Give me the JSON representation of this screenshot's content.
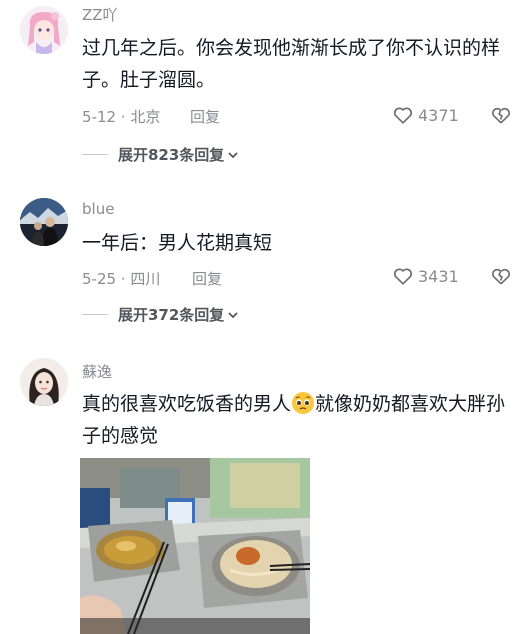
{
  "comments": [
    {
      "username": "ZZ吖",
      "text": "过几年之后。你会发现他渐渐长成了你不认识的样子。肚子溜圆。",
      "date_location": "5-12 · 北京",
      "reply_label": "回复",
      "likes": "4371",
      "expand_label": "展开823条回复"
    },
    {
      "username": "blue",
      "text": "一年后：男人花期真短",
      "date_location": "5-25 · 四川",
      "reply_label": "回复",
      "likes": "3431",
      "expand_label": "展开372条回复"
    },
    {
      "username": "蘇逸",
      "text_part1": "真的很喜欢吃饭香的男人",
      "text_part2": "就像奶奶都喜欢大胖孙子的感觉",
      "emoji": "pleading-face-emoji"
    }
  ],
  "colors": {
    "text": "#161823",
    "muted": "#8a8b91",
    "expand": "#55565c"
  }
}
